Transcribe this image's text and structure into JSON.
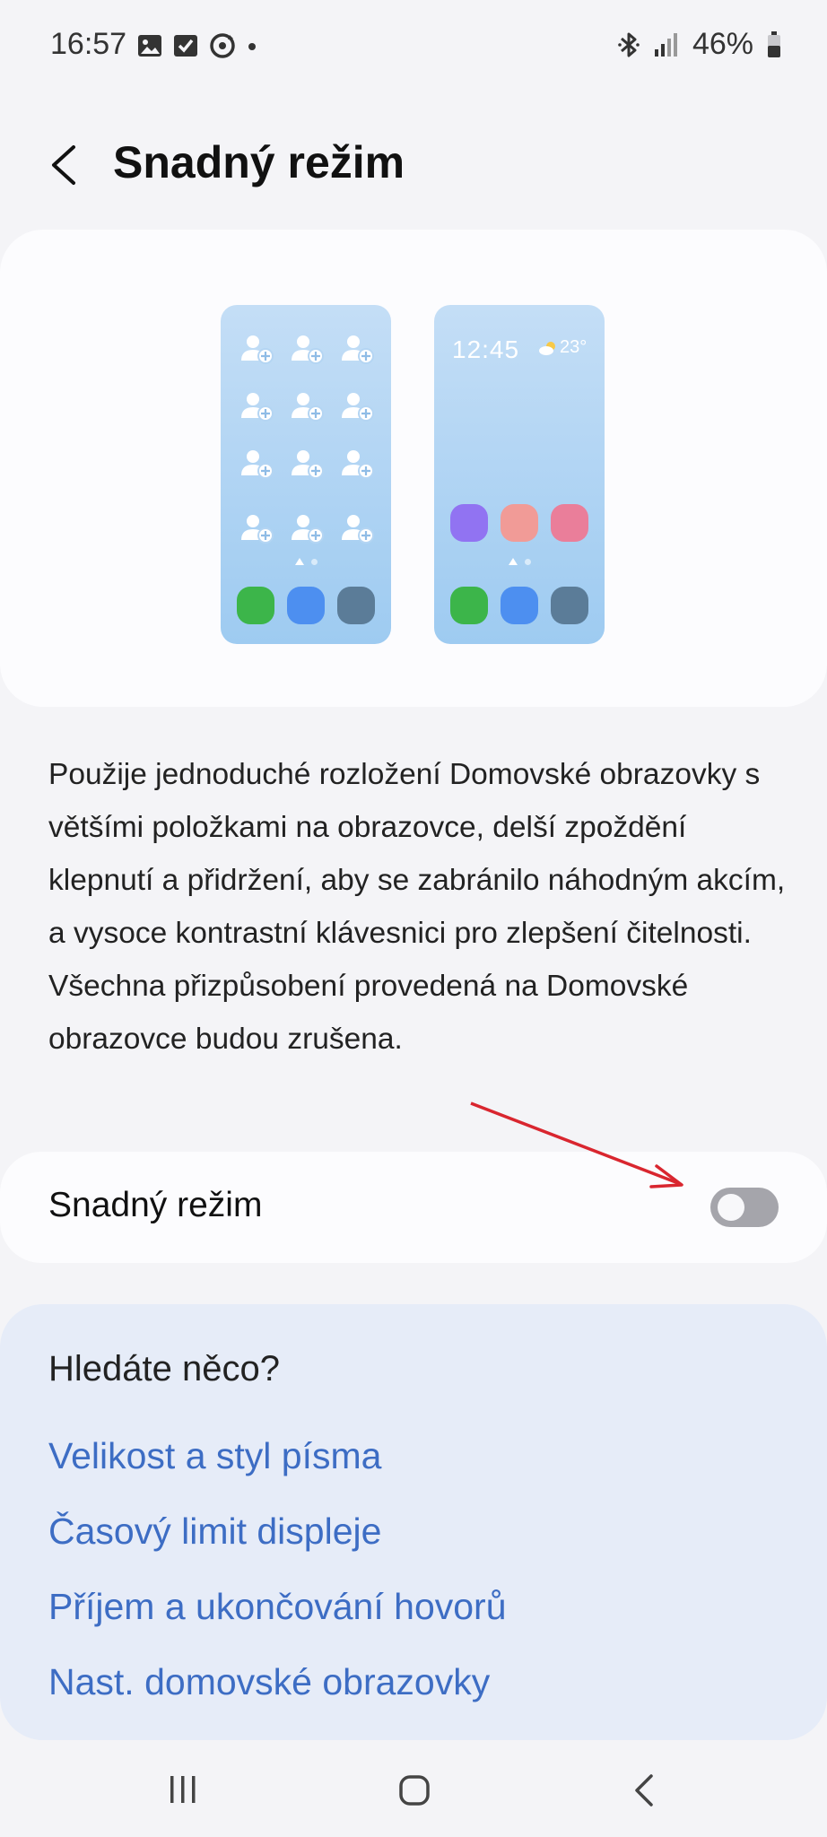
{
  "status_bar": {
    "time": "16:57",
    "battery": "46%",
    "left_icons": [
      "gallery-icon",
      "checkbox-icon",
      "sync-icon",
      "dot-icon"
    ],
    "right_icons": [
      "bluetooth-icon",
      "signal-icon",
      "battery-icon"
    ]
  },
  "header": {
    "title": "Snadný režim"
  },
  "preview": {
    "clock": "12:45",
    "weather": "23°"
  },
  "description": "Použije jednoduché rozložení Domovské obrazovky s většími položkami na obrazovce, delší zpoždění klepnutí a přidržení, aby se zabránilo náhodným akcím, a vysoce kontrastní klávesnici pro zlepšení čitelnosti. Všechna přizpůsobení provedená na Domovské obrazovce budou zrušena.",
  "toggle": {
    "label": "Snadný režim",
    "enabled": false
  },
  "suggestions": {
    "title": "Hledáte něco?",
    "links": [
      "Velikost a styl písma",
      "Časový limit displeje",
      "Příjem a ukončování hovorů",
      "Nast. domovské obrazovky"
    ]
  },
  "colors": {
    "accent_link": "#3d6dc4",
    "annotation_arrow": "#d9262f",
    "switch_off": "#a5a5ab",
    "app_green": "#3cb54a",
    "app_blue": "#4d8ff0",
    "app_slate": "#5b7c98",
    "app_purple": "#9173f2",
    "app_salmon": "#f19b97",
    "app_pink": "#ea7e9a"
  }
}
